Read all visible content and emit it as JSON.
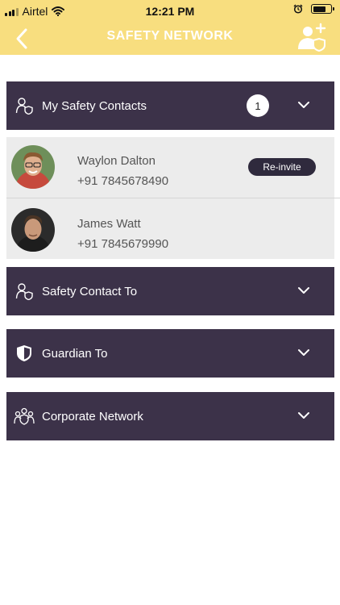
{
  "status_bar": {
    "carrier": "Airtel",
    "time": "12:21 PM",
    "battery_level": 0.75
  },
  "nav": {
    "title": "SAFETY NETWORK",
    "back_icon": "chevron-left-icon",
    "add_icon": "add-contact-icon"
  },
  "sections": [
    {
      "label": "My Safety Contacts",
      "icon": "safety-contact-icon",
      "badge": "1",
      "expanded": true
    },
    {
      "label": "Safety Contact To",
      "icon": "safety-contact-icon"
    },
    {
      "label": "Guardian To",
      "icon": "shield-icon"
    },
    {
      "label": "Corporate Network",
      "icon": "corporate-network-icon"
    }
  ],
  "contacts": [
    {
      "name": "Waylon Dalton",
      "phone": "+91 7845678490",
      "action": "Re-invite"
    },
    {
      "name": "James Watt",
      "phone": "+91 7845679990"
    }
  ],
  "colors": {
    "header_bg": "#f8de7f",
    "section_bg": "#3c3249",
    "contacts_bg": "#ececec",
    "button_bg": "#2f2a3d"
  }
}
